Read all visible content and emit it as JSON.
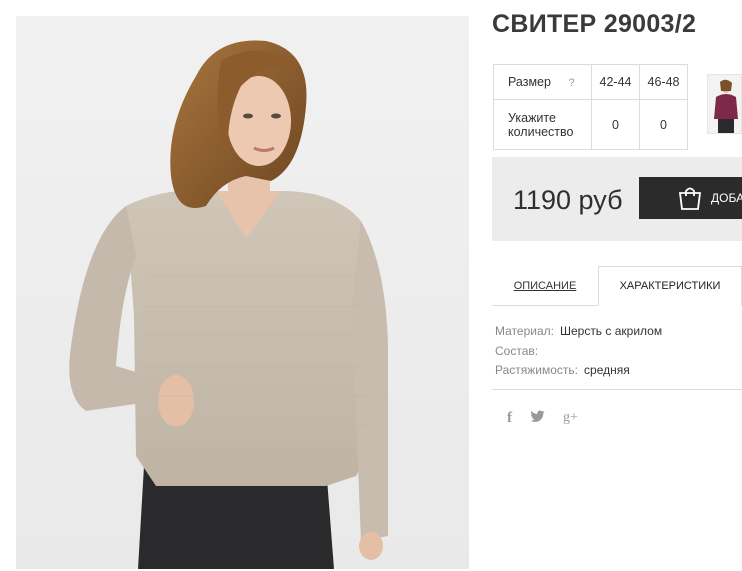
{
  "product": {
    "title": "СВИТЕР 29003/2",
    "photo_icon": "model-photo",
    "thumbnail_icon": "product-thumbnail"
  },
  "size_table": {
    "size_label": "Размер",
    "help_mark": "?",
    "sizes": [
      "42-44",
      "46-48"
    ],
    "quantity_label_line1": "Укажите",
    "quantity_label_line2": "количество",
    "quantities": [
      "0",
      "0"
    ]
  },
  "price": {
    "value": "1190 руб",
    "buy_label": "ДОБАВИТЬ В КОРЗИНУ",
    "bag_icon": "shopping-bag-icon"
  },
  "tabs": [
    {
      "label": "ОПИСАНИЕ",
      "active": false
    },
    {
      "label": "ХАРАКТЕРИСТИКИ",
      "active": true
    }
  ],
  "specs": [
    {
      "key": "Материал:",
      "value": "Шерсть с акрилом"
    },
    {
      "key": "Состав:",
      "value": ""
    },
    {
      "key": "Растяжимость:",
      "value": "средняя"
    }
  ],
  "social": {
    "facebook": "f",
    "twitter": "twitter-icon",
    "googleplus": "g+"
  },
  "colors": {
    "button_bg": "#2b2b2b",
    "price_bg": "#ececec",
    "sweater": "#c9bfb1"
  }
}
